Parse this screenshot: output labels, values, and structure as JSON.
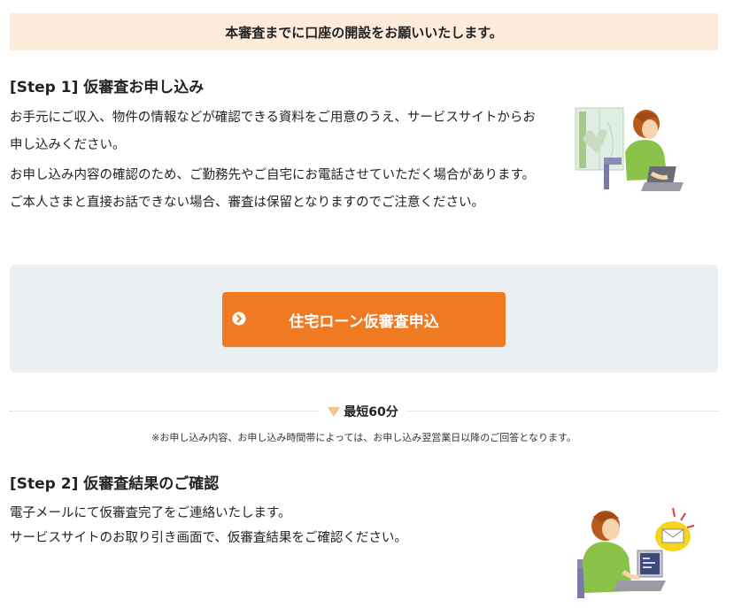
{
  "notice": {
    "text": "本審査までに口座の開設をお願いいたします。"
  },
  "step1": {
    "title": "[Step 1] 仮審査お申し込み",
    "paragraph1": "お手元にご収入、物件の情報などが確認できる資料をご用意のうえ、サービスサイトからお申し込みください。",
    "paragraph2": "お申し込み内容の確認のため、ご勤務先やご自宅にお電話させていただく場合があります。ご本人さまと直接お話できない場合、審査は保留となりますのでご注意ください。"
  },
  "cta": {
    "label": "住宅ローン仮審査申込",
    "icon": "chevron-circle-right-icon"
  },
  "duration": {
    "label": "最短60分",
    "note": "※お申し込み内容、お申し込み時間帯によっては、お申し込み翌営業日以降のご回答となります。"
  },
  "step2": {
    "title": "[Step 2] 仮審査結果のご確認",
    "line1": "電子メールにて仮審査完了をご連絡いたします。",
    "line2": "サービスサイトのお取り引き画面で、仮審査結果をご確認ください。"
  },
  "colors": {
    "notice_bg": "#fdebdc",
    "cta_bg": "#ef7a22",
    "panel_bg": "#eaeff2",
    "triangle": "#f2c28e"
  }
}
